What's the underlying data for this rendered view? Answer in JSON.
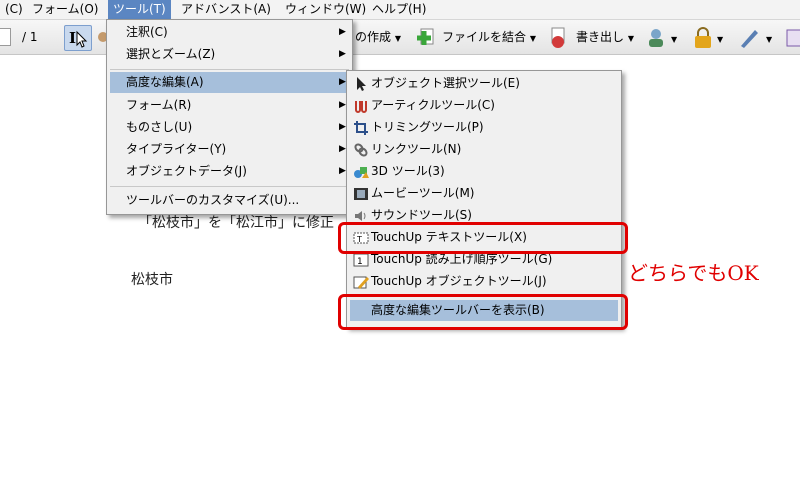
{
  "menubar": {
    "items": [
      {
        "label": "(C)"
      },
      {
        "label": "フォーム(O)"
      },
      {
        "label": "ツール(T)"
      },
      {
        "label": "アドバンスト(A)"
      },
      {
        "label": "ウィンドウ(W)"
      },
      {
        "label": "ヘルプ(H)"
      }
    ]
  },
  "toolbar": {
    "page_total": "/ 1",
    "create_label": "の作成",
    "combine_label": "ファイルを結合",
    "export_label": "書き出し"
  },
  "document": {
    "line1": "「松枝市」を「松江市」に修正",
    "line2": "松枝市"
  },
  "tools_menu": {
    "items": [
      {
        "label": "注釈(C)"
      },
      {
        "label": "選択とズーム(Z)"
      },
      {
        "label": "高度な編集(A)"
      },
      {
        "label": "フォーム(R)"
      },
      {
        "label": "ものさし(U)"
      },
      {
        "label": "タイプライター(Y)"
      },
      {
        "label": "オブジェクトデータ(J)"
      },
      {
        "label": "ツールバーのカスタマイズ(U)..."
      }
    ]
  },
  "advanced_menu": {
    "items": [
      {
        "label": "オブジェクト選択ツール(E)",
        "icon": "pointer-icon"
      },
      {
        "label": "アーティクルツール(C)",
        "icon": "article-icon"
      },
      {
        "label": "トリミングツール(P)",
        "icon": "crop-icon"
      },
      {
        "label": "リンクツール(N)",
        "icon": "link-icon"
      },
      {
        "label": "3D ツール(3)",
        "icon": "3d-icon"
      },
      {
        "label": "ムービーツール(M)",
        "icon": "film-icon"
      },
      {
        "label": "サウンドツール(S)",
        "icon": "sound-icon"
      },
      {
        "label": "TouchUp テキストツール(X)",
        "icon": "touchup-text-icon"
      },
      {
        "label": "TouchUp 読み上げ順序ツール(G)",
        "icon": "reading-order-icon"
      },
      {
        "label": "TouchUp オブジェクトツール(J)",
        "icon": "touchup-object-icon"
      },
      {
        "label": "高度な編集ツールバーを表示(B)"
      }
    ]
  },
  "annotation": {
    "note": "どちらでもOK",
    "color": "#e00000"
  },
  "colors": {
    "menu_highlight": "#a6bfdb",
    "menubar_active": "#5b86c2"
  }
}
